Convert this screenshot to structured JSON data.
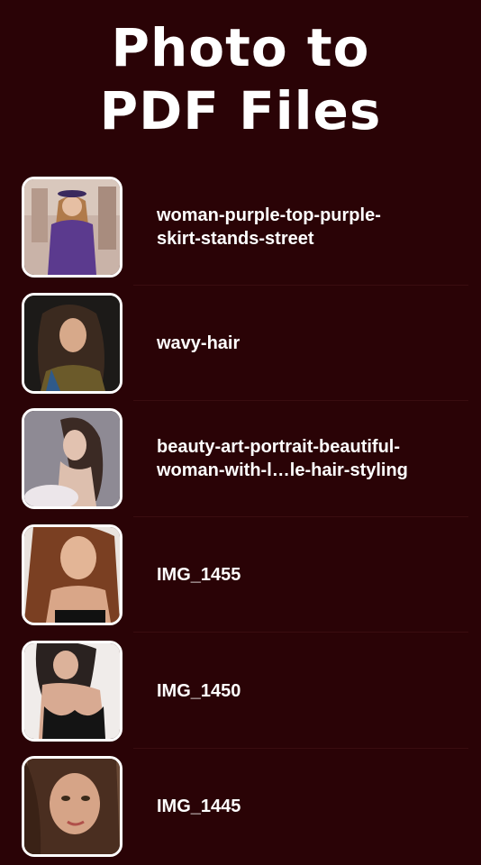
{
  "header": {
    "title_line1": "Photo to",
    "title_line2": "PDF Files"
  },
  "files": [
    {
      "name": "woman-purple-top-purple-skirt-stands-street",
      "line1": "woman-purple-top-purple-",
      "line2": "skirt-stands-street",
      "thumb": "photo-thumbnail-woman-purple-outfit"
    },
    {
      "name": "wavy-hair",
      "line1": "wavy-hair",
      "line2": "",
      "thumb": "photo-thumbnail-woman-wavy-hair"
    },
    {
      "name": "beauty-art-portrait-beautiful-woman-with-l…le-hair-styling",
      "line1": "beauty-art-portrait-beautiful-",
      "line2": "woman-with-l…le-hair-styling",
      "thumb": "photo-thumbnail-beauty-portrait"
    },
    {
      "name": "IMG_1455",
      "line1": "IMG_1455",
      "line2": "",
      "thumb": "photo-thumbnail-woman-long-hair"
    },
    {
      "name": "IMG_1450",
      "line1": "IMG_1450",
      "line2": "",
      "thumb": "photo-thumbnail-woman-black-top"
    },
    {
      "name": "IMG_1445",
      "line1": "IMG_1445",
      "line2": "",
      "thumb": "photo-thumbnail-woman-closeup"
    }
  ],
  "colors": {
    "background": "#2a0306",
    "text": "#ffffff",
    "thumb_border": "#ffffff"
  }
}
